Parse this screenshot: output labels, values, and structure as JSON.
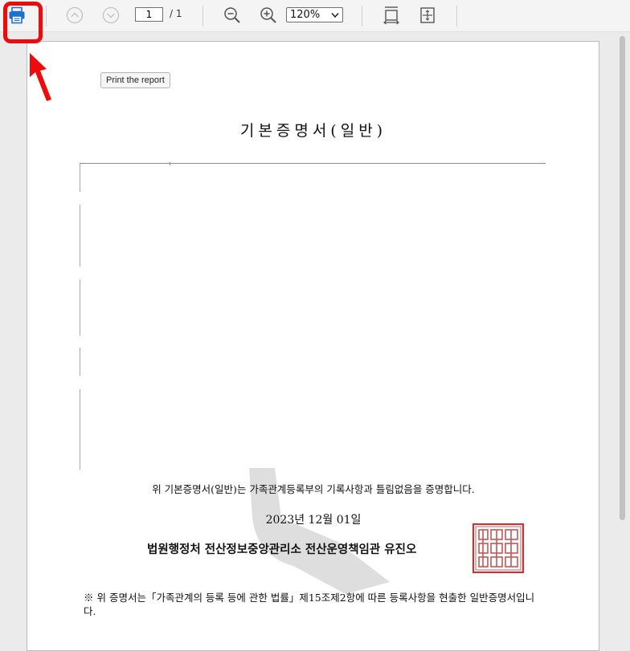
{
  "toolbar": {
    "page_number": "1",
    "page_total": "/ 1",
    "zoom": "120%",
    "zoom_options": [
      "120%"
    ],
    "accent_color": "#1d6fd1",
    "highlight_color": "#ee0b0b",
    "icons": [
      "print-icon",
      "previous-page-icon",
      "next-page-icon",
      "zoom-out-icon",
      "zoom-in-icon",
      "fit-width-icon",
      "fit-page-icon"
    ]
  },
  "tooltip": "Print the report",
  "document": {
    "title": "기본증명서(일반)",
    "statement": "위 기본증명서(일반)는 가족관계등록부의 기록사항과 틀림없음을 증명합니다.",
    "date": "2023년 12월 01일",
    "issuer": "법원행정처 전산정보중앙관리소 전산운영책임관 유진오",
    "note": "※ 위 증명서는「가족관계의 등록 등에 관한 법률」제15조제2항에 따른 등록사항을 현출한 일반증명서입니다."
  }
}
